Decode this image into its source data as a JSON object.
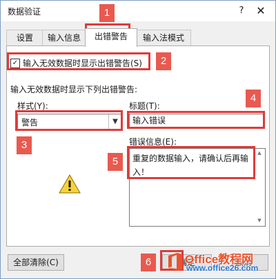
{
  "window": {
    "title": "数据验证",
    "help": "?",
    "close": "✕"
  },
  "tabs": [
    {
      "label": "设置"
    },
    {
      "label": "输入信息"
    },
    {
      "label": "出错警告"
    },
    {
      "label": "输入法模式"
    }
  ],
  "options": {
    "show_error_alert": {
      "checked": true,
      "label": "输入无效数据时显示出错警告(S)"
    },
    "group_label": "输入无效数据时显示下列出错警告:"
  },
  "style": {
    "label": "样式(Y):",
    "value": "警告",
    "icon": "warning-icon"
  },
  "error_title": {
    "label": "标题(T):",
    "value": "输入错误"
  },
  "error_message": {
    "label": "错误信息(E):",
    "value": "重复的数据输入，请确认后再输入！"
  },
  "buttons": {
    "clear_all": "全部清除(C)",
    "ok": "确定",
    "cancel": "取消"
  },
  "annotations": [
    "1",
    "2",
    "3",
    "4",
    "5",
    "6"
  ],
  "watermark": {
    "name": "Office教程网",
    "url": "www.office26.com"
  },
  "colors": {
    "annotation": "#e03a3a",
    "panel_bg": "#ffffff",
    "dialog_bg": "#f0f0f0"
  }
}
